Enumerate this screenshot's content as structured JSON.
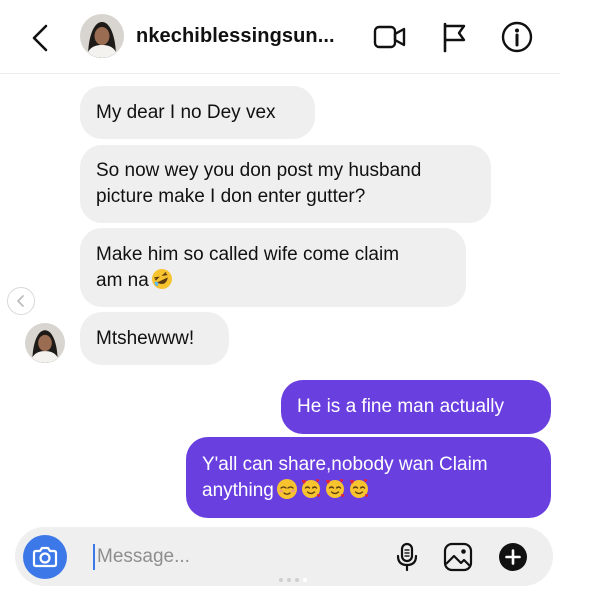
{
  "header": {
    "username": "nkechiblessingsun...",
    "back_icon": "chevron-left-icon",
    "video_icon": "video-camera-icon",
    "flag_icon": "flag-icon",
    "info_icon": "info-icon"
  },
  "messages": {
    "m1": "My dear I no Dey vex",
    "m2_line1": "So now wey you don post my husband",
    "m2_line2": "picture make I don enter gutter?",
    "m3_line1": "Make him so called wife come claim",
    "m3_line2": "am na",
    "m4": "Mtshewww!",
    "m5": "He is a fine man actually",
    "m6_line1": "Y'all can share,nobody wan Claim",
    "m6_line2": "anything"
  },
  "composer": {
    "placeholder": "Message...",
    "value": ""
  },
  "colors": {
    "outgoing_bubble": "#6a3fe0",
    "incoming_bubble": "#efefef",
    "camera_button": "#3d78e8"
  },
  "page_indicator": {
    "count": 4,
    "active_index": 3
  }
}
